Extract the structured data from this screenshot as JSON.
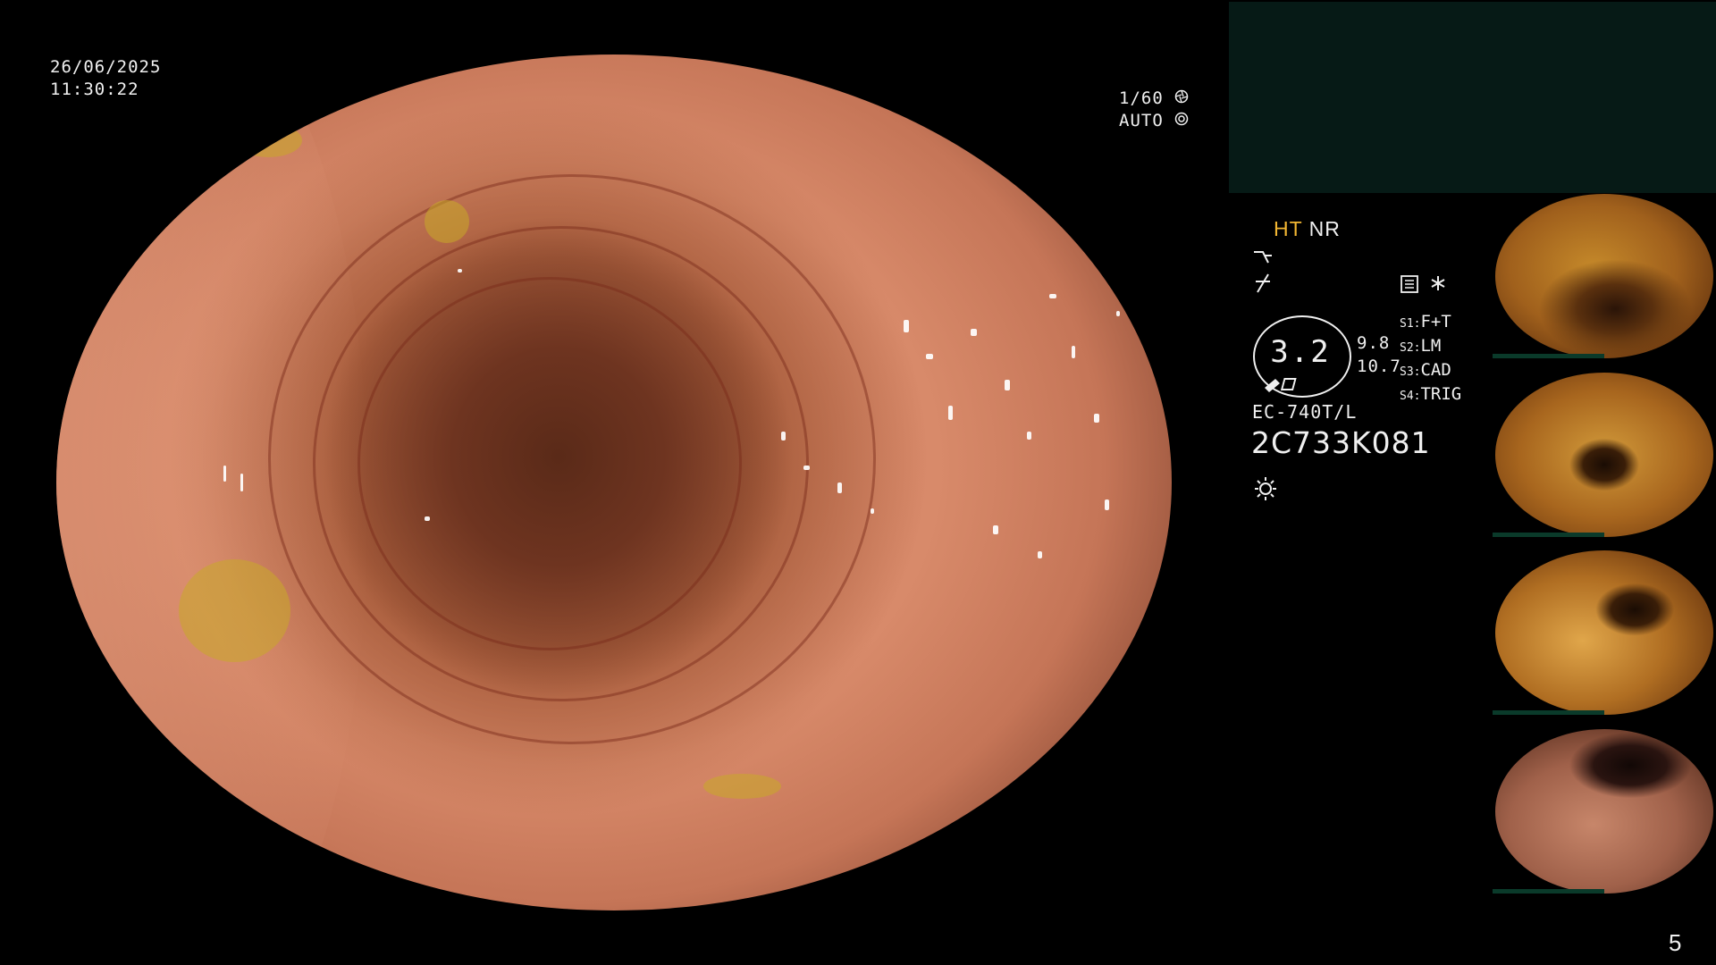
{
  "overlay": {
    "date": "26/06/2025",
    "time": "11:30:22",
    "shutter": "1/60",
    "iris_mode": "AUTO",
    "ht": "HT",
    "nr": "NR",
    "zoom": "3.2",
    "values": [
      "9.8",
      "10.7"
    ],
    "scope_model": "EC-740T/L",
    "serial": "2C733K081",
    "page_number": "5",
    "switches": [
      {
        "key": "S1",
        "value": "F+T"
      },
      {
        "key": "S2",
        "value": "LM"
      },
      {
        "key": "S3",
        "value": "CAD"
      },
      {
        "key": "S4",
        "value": "TRIG"
      }
    ]
  },
  "icons": {
    "shutter": "aperture-icon",
    "iris": "target-icon",
    "structure": "enhancement-curve-icon",
    "color": "color-enhance-icon",
    "memo": "memo-icon",
    "star": "asterisk-icon",
    "light": "light-source-icon"
  },
  "colors": {
    "ht_accent": "#f2b632",
    "panel": "#061a16"
  },
  "thumbnails_count": 4
}
